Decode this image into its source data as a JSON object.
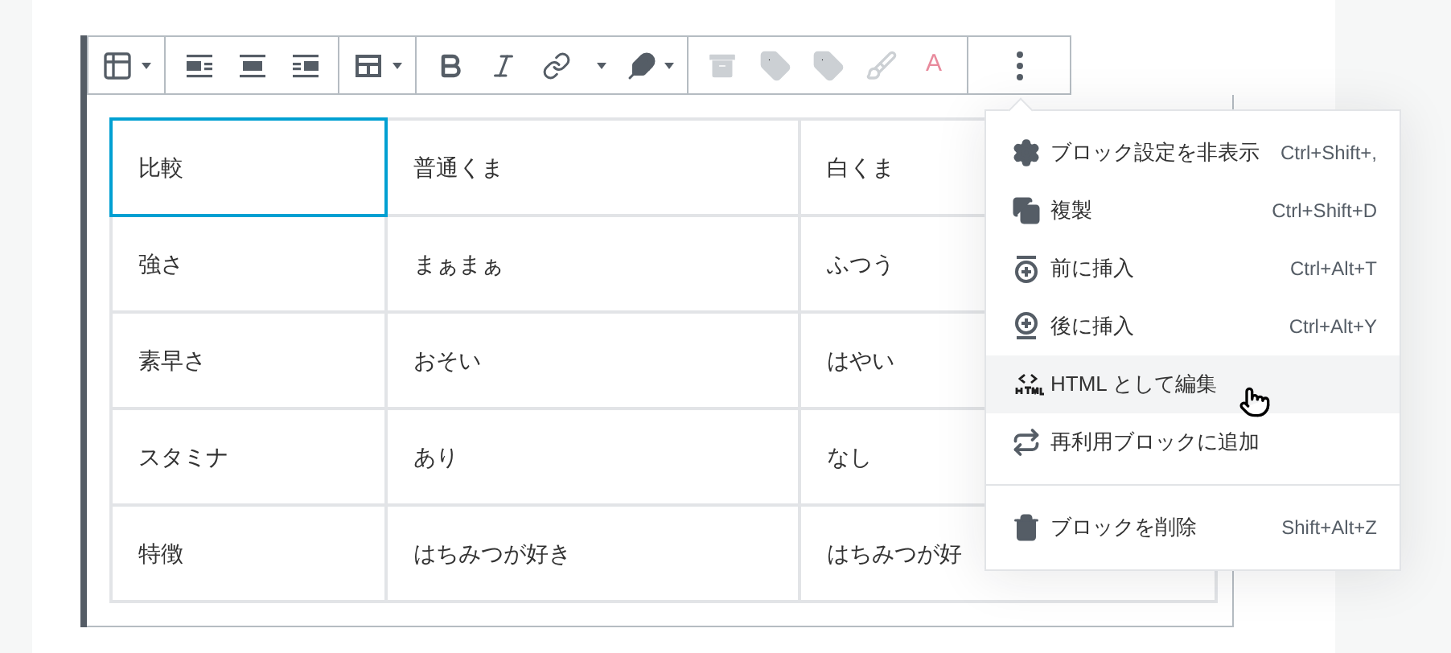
{
  "toolbar": {
    "groups": [
      [
        {
          "kind": "table",
          "has_menu": true,
          "disabled": false
        }
      ],
      [
        {
          "kind": "wrapleft",
          "has_menu": false,
          "disabled": false
        },
        {
          "kind": "center",
          "has_menu": false,
          "disabled": false
        },
        {
          "kind": "wrapright",
          "has_menu": false,
          "disabled": false
        }
      ],
      [
        {
          "kind": "tableedit",
          "has_menu": true,
          "disabled": false
        }
      ],
      [
        {
          "kind": "bold",
          "has_menu": false,
          "disabled": false
        },
        {
          "kind": "italic",
          "has_menu": false,
          "disabled": false
        },
        {
          "kind": "link",
          "has_menu": false,
          "disabled": false
        },
        {
          "kind": "more",
          "has_menu": true,
          "disabled": false
        },
        {
          "kind": "feather",
          "has_menu": true,
          "disabled": false
        }
      ],
      [
        {
          "kind": "archive",
          "has_menu": false,
          "disabled": true
        },
        {
          "kind": "tag",
          "has_menu": false,
          "disabled": true
        },
        {
          "kind": "tag",
          "has_menu": false,
          "disabled": true
        },
        {
          "kind": "brush",
          "has_menu": false,
          "disabled": true
        },
        {
          "kind": "color",
          "label": "A",
          "has_menu": false,
          "disabled": true
        }
      ],
      [
        {
          "kind": "options",
          "has_menu": false,
          "disabled": false
        }
      ]
    ]
  },
  "table": {
    "rows": [
      [
        {
          "text": "比較",
          "selected": true
        },
        {
          "text": "普通くま",
          "selected": false
        },
        {
          "text": "白くま",
          "selected": false
        }
      ],
      [
        {
          "text": "強さ",
          "selected": false
        },
        {
          "text": "まぁまぁ",
          "selected": false
        },
        {
          "text": "ふつう",
          "selected": false
        }
      ],
      [
        {
          "text": "素早さ",
          "selected": false
        },
        {
          "text": "おそい",
          "selected": false
        },
        {
          "text": "はやい",
          "selected": false
        }
      ],
      [
        {
          "text": "スタミナ",
          "selected": false
        },
        {
          "text": "あり",
          "selected": false
        },
        {
          "text": "なし",
          "selected": false
        }
      ],
      [
        {
          "text": "特徴",
          "selected": false
        },
        {
          "text": "はちみつが好き",
          "selected": false
        },
        {
          "text": "はちみつが好",
          "selected": false
        }
      ]
    ]
  },
  "menu": {
    "groups": [
      [
        {
          "kind": "gear",
          "label": "ブロック設定を非表示",
          "shortcut": "Ctrl+Shift+,",
          "hovered": false
        },
        {
          "kind": "copy",
          "label": "複製",
          "shortcut": "Ctrl+Shift+D",
          "hovered": false
        },
        {
          "kind": "before",
          "label": "前に挿入",
          "shortcut": "Ctrl+Alt+T",
          "hovered": false
        },
        {
          "kind": "after",
          "label": "後に挿入",
          "shortcut": "Ctrl+Alt+Y",
          "hovered": false
        },
        {
          "kind": "html",
          "label": "HTML として編集",
          "hovered": true
        },
        {
          "kind": "reuse",
          "label": "再利用ブロックに追加",
          "hovered": false
        }
      ],
      [
        {
          "kind": "trash",
          "label": "ブロックを削除",
          "shortcut": "Shift+Alt+Z",
          "hovered": false
        }
      ]
    ]
  }
}
